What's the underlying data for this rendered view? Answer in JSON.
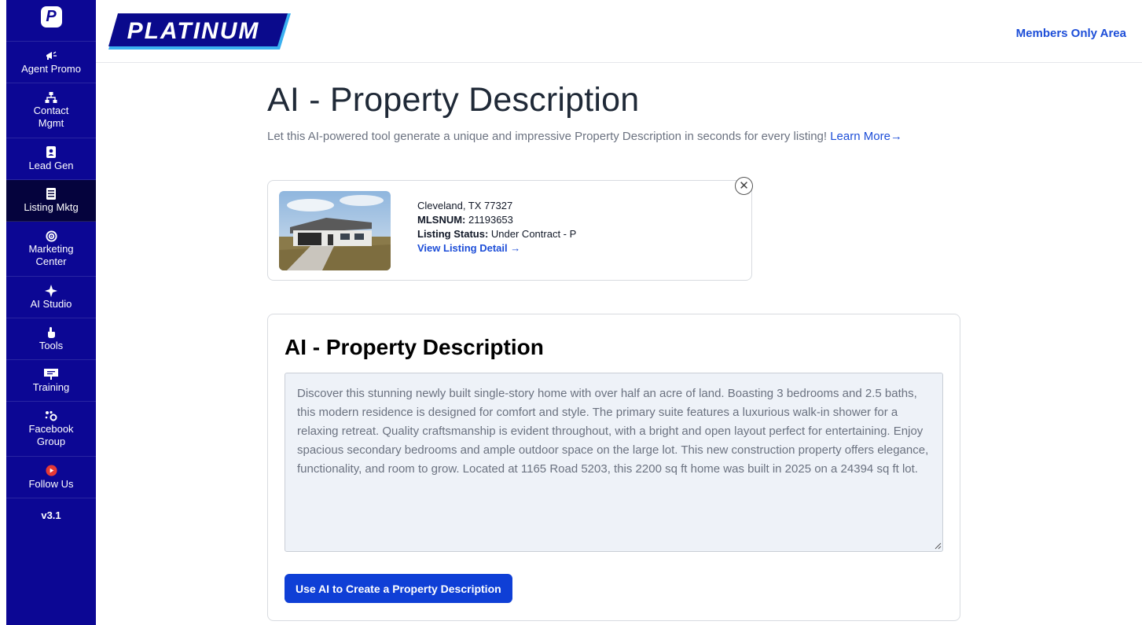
{
  "sidebar": {
    "logo_letter": "P",
    "items": [
      {
        "label": "Agent Promo",
        "icon": "megaphone-icon"
      },
      {
        "label": "Contact Mgmt",
        "icon": "sitemap-icon"
      },
      {
        "label": "Lead Gen",
        "icon": "contact-card-icon"
      },
      {
        "label": "Listing Mktg",
        "icon": "document-list-icon",
        "active": true
      },
      {
        "label": "Marketing Center",
        "icon": "target-icon"
      },
      {
        "label": "AI Studio",
        "icon": "sparkle-icon"
      },
      {
        "label": "Tools",
        "icon": "hand-pointer-icon"
      },
      {
        "label": "Training",
        "icon": "presentation-board-icon"
      },
      {
        "label": "Facebook Group",
        "icon": "group-icon"
      },
      {
        "label": "Follow Us",
        "icon": "youtube-icon"
      }
    ],
    "version": "v3.1"
  },
  "header": {
    "brand": "PLATINUM",
    "members_link": "Members Only Area"
  },
  "main": {
    "title": "AI - Property Description",
    "subtitle": "Let this AI-powered tool generate a unique and impressive Property Description in seconds for every listing!",
    "learn_more": "Learn More→"
  },
  "listing": {
    "location": "Cleveland, TX 77327",
    "mls_label": "MLSNUM:",
    "mls_value": "21193653",
    "status_label": "Listing Status:",
    "status_value": "Under Contract - P",
    "view_detail": "View Listing Detail →",
    "close_symbol": "✕"
  },
  "description": {
    "heading": "AI - Property Description",
    "text": "Discover this stunning newly built single-story home with over half an acre of land. Boasting 3 bedrooms and 2.5 baths, this modern residence is designed for comfort and style. The primary suite features a luxurious walk-in shower for a relaxing retreat. Quality craftsmanship is evident throughout, with a bright and open layout perfect for entertaining. Enjoy spacious secondary bedrooms and ample outdoor space on the large lot. This new construction property offers elegance, functionality, and room to grow. Located at 1165 Road 5203, this 2200 sq ft home was built in 2025 on a 24394 sq ft lot.",
    "button": "Use AI to Create a Property Description"
  },
  "colors": {
    "sidebar_bg": "#0c0794",
    "sidebar_active": "#05033d",
    "link": "#1d4ed8",
    "button": "#0f3fd6",
    "textarea_bg": "#eef2f8"
  }
}
